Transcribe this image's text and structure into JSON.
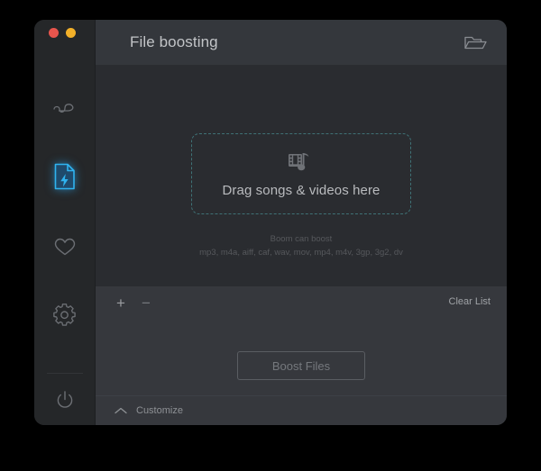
{
  "window": {
    "traffic_lights": [
      {
        "name": "close",
        "color": "#e8554d"
      },
      {
        "name": "minimize",
        "color": "#f2b029"
      }
    ]
  },
  "sidebar": {
    "items": [
      {
        "id": "equalizer",
        "icon": "wave-equalizer-icon",
        "active": false
      },
      {
        "id": "file-boosting",
        "icon": "file-boost-icon",
        "active": true,
        "accent": "#2aa3e8"
      },
      {
        "id": "favorites",
        "icon": "heart-icon",
        "active": false
      },
      {
        "id": "settings",
        "icon": "gear-icon",
        "active": false
      },
      {
        "id": "power",
        "icon": "power-icon",
        "active": false
      }
    ]
  },
  "header": {
    "title": "File boosting",
    "folder_icon": "open-folder-icon"
  },
  "main": {
    "dropzone": {
      "label": "Drag songs & videos here",
      "icon": "film-music-icon",
      "border_color": "#3f7276"
    },
    "formats": {
      "heading": "Boom can boost",
      "list": "mp3, m4a, aiff, caf, wav, mov, mp4, m4v, 3gp, 3g2, dv"
    }
  },
  "bottom": {
    "add_label": "+",
    "remove_label": "−",
    "clear_list_label": "Clear List",
    "boost_button_label": "Boost Files",
    "customize_label": "Customize",
    "customize_icon": "chevron-up-icon"
  }
}
